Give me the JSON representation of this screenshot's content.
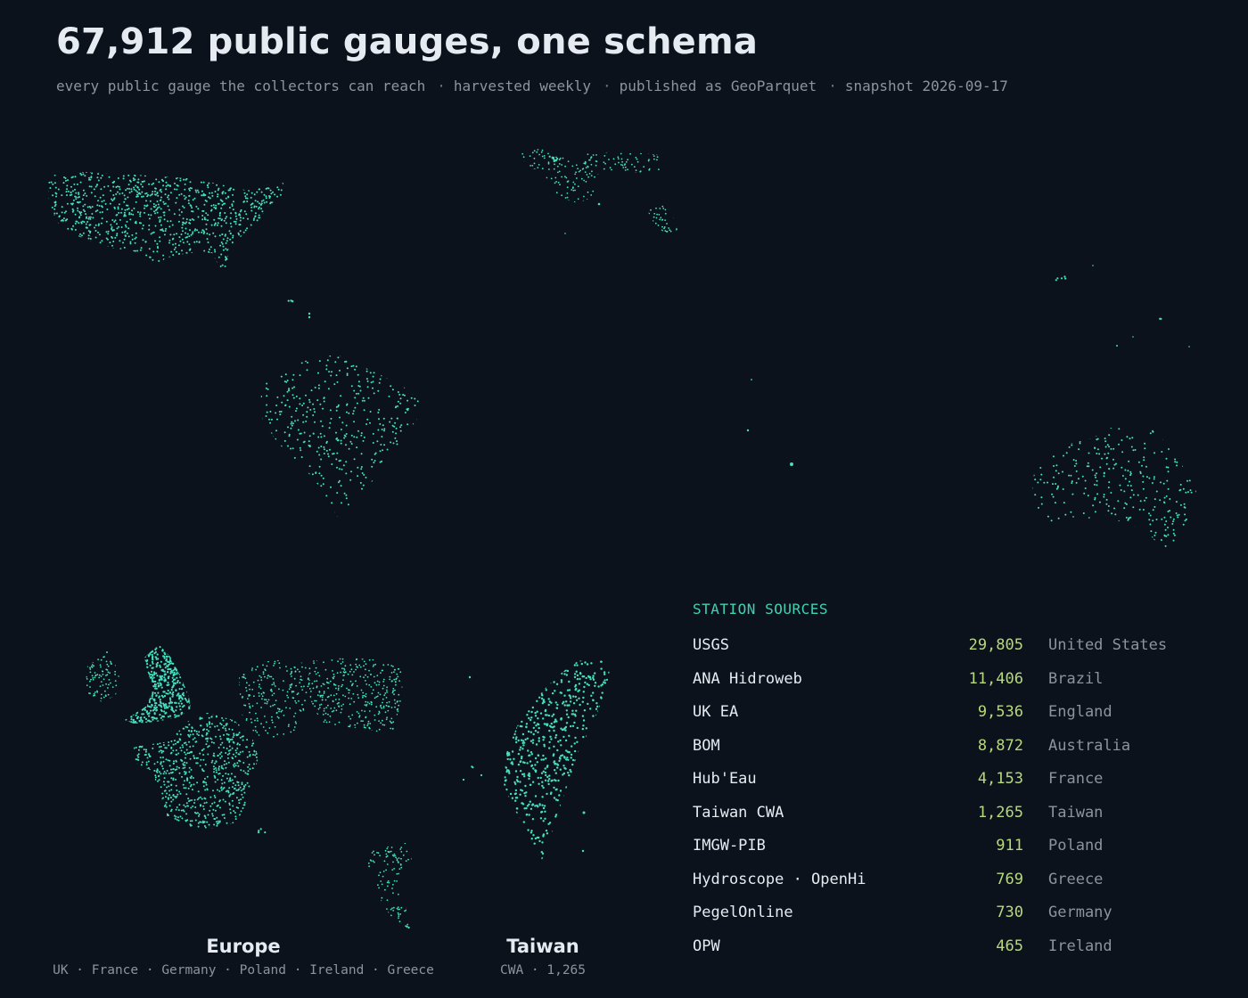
{
  "title": "67,912 public gauges, one schema",
  "subtitle": {
    "parts": [
      "every public gauge the collectors can reach",
      "harvested weekly",
      "published as GeoParquet",
      "snapshot 2026-09-17"
    ],
    "separator": "·"
  },
  "colors": {
    "background": "#0c121b",
    "station_dot": "#46e0c0",
    "title": "#e6ebf2",
    "muted": "#8b949e",
    "legend_heading": "#3fd2b4",
    "count": "#b7d97a"
  },
  "insets": {
    "europe": {
      "label": "Europe",
      "sub": "UK · France · Germany · Poland · Ireland · Greece"
    },
    "taiwan": {
      "label": "Taiwan",
      "sub": "CWA · 1,265"
    }
  },
  "legend": {
    "heading": "STATION SOURCES",
    "sources": [
      {
        "name": "USGS",
        "count": "29,805",
        "country": "United States"
      },
      {
        "name": "ANA Hidroweb",
        "count": "11,406",
        "country": "Brazil"
      },
      {
        "name": "UK EA",
        "count": "9,536",
        "country": "England"
      },
      {
        "name": "BOM",
        "count": "8,872",
        "country": "Australia"
      },
      {
        "name": "Hub'Eau",
        "count": "4,153",
        "country": "France"
      },
      {
        "name": "Taiwan CWA",
        "count": "1,265",
        "country": "Taiwan"
      },
      {
        "name": "IMGW-PIB",
        "count": "911",
        "country": "Poland"
      },
      {
        "name": "Hydroscope · OpenHi",
        "count": "769",
        "country": "Greece"
      },
      {
        "name": "PegelOnline",
        "count": "730",
        "country": "Germany"
      },
      {
        "name": "OPW",
        "count": "465",
        "country": "Ireland"
      }
    ]
  }
}
